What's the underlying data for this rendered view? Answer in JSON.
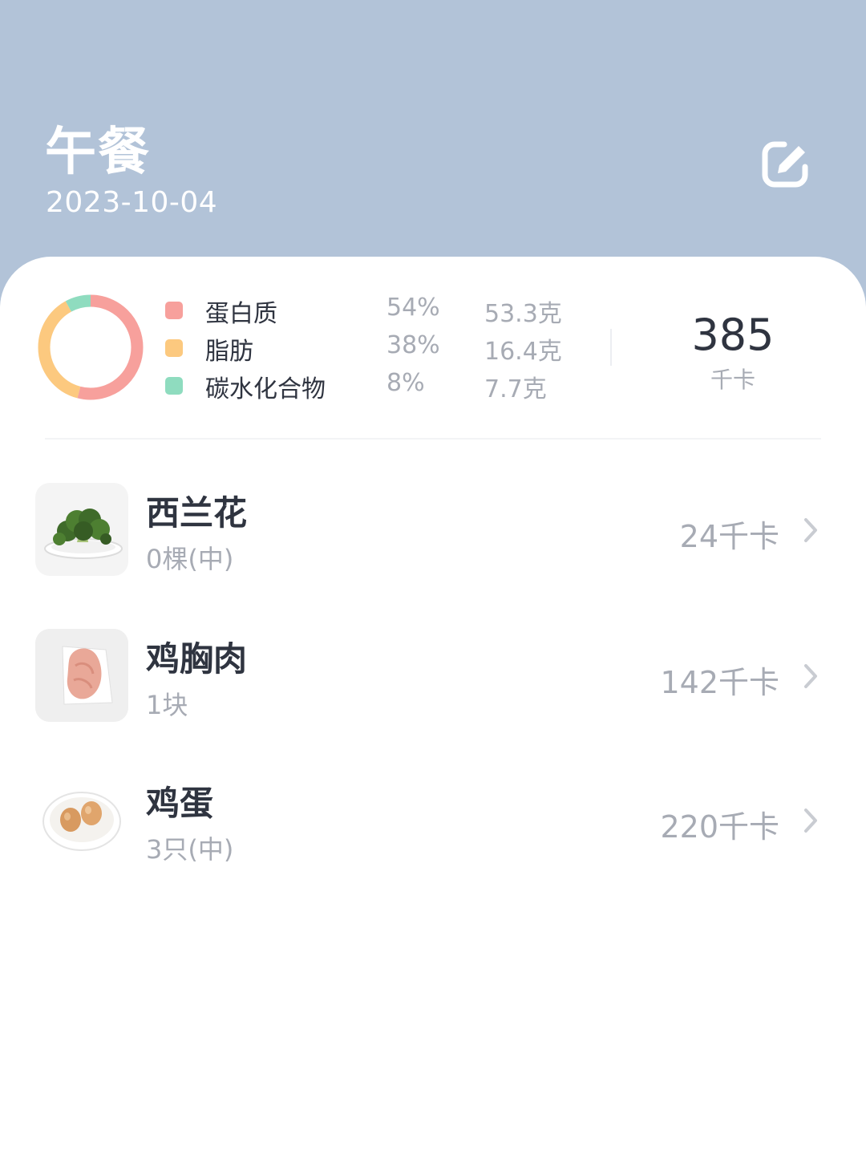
{
  "header": {
    "title": "午餐",
    "date": "2023-10-04",
    "edit_icon": "edit-icon"
  },
  "summary": {
    "macros": [
      {
        "name": "蛋白质",
        "percent": "54%",
        "grams": "53.3克",
        "color": "#f7a09c",
        "fraction": 0.54
      },
      {
        "name": "脂肪",
        "percent": "38%",
        "grams": "16.4克",
        "color": "#fcc97f",
        "fraction": 0.38
      },
      {
        "name": "碳水化合物",
        "percent": "8%",
        "grams": "7.7克",
        "color": "#8fdcbf",
        "fraction": 0.08
      }
    ],
    "total_kcal": "385",
    "total_unit": "千卡"
  },
  "foods": [
    {
      "name": "西兰花",
      "amount": "0棵(中)",
      "kcal": "24千卡",
      "thumb_icon": "broccoli-image"
    },
    {
      "name": "鸡胸肉",
      "amount": "1块",
      "kcal": "142千卡",
      "thumb_icon": "chicken-breast-image"
    },
    {
      "name": "鸡蛋",
      "amount": "3只(中)",
      "kcal": "220千卡",
      "thumb_icon": "eggs-image"
    }
  ],
  "colors": {
    "header_bg": "#b2c3d8",
    "text_dark": "#2f3440",
    "text_muted": "#a7abb4"
  }
}
